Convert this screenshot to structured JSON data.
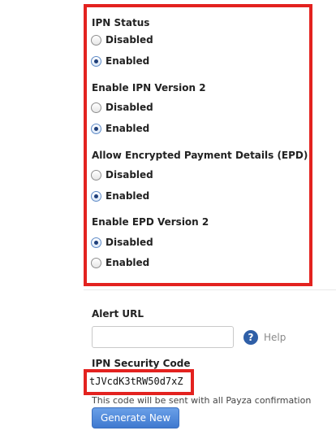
{
  "ipn_status": {
    "label": "IPN Status",
    "options": [
      {
        "label": "Disabled",
        "checked": false
      },
      {
        "label": "Enabled",
        "checked": true
      }
    ]
  },
  "ipn_version2": {
    "label": "Enable IPN Version 2",
    "options": [
      {
        "label": "Disabled",
        "checked": false
      },
      {
        "label": "Enabled",
        "checked": true
      }
    ]
  },
  "epd": {
    "label": "Allow Encrypted Payment Details (EPD)",
    "options": [
      {
        "label": "Disabled",
        "checked": false
      },
      {
        "label": "Enabled",
        "checked": true
      }
    ]
  },
  "epd_version2": {
    "label": "Enable EPD Version 2",
    "options": [
      {
        "label": "Disabled",
        "checked": true
      },
      {
        "label": "Enabled",
        "checked": false
      }
    ]
  },
  "alert_url": {
    "label": "Alert URL",
    "value": "",
    "help_label": "Help"
  },
  "security_code": {
    "label": "IPN Security Code",
    "value": "tJVcdK3tRW50d7xZ",
    "note": "This code will be sent with all Payza confirmation",
    "generate_label": "Generate New"
  },
  "colors": {
    "highlight": "#e3221f",
    "button": "#3f79cf",
    "help_icon": "#2f5fa7"
  }
}
